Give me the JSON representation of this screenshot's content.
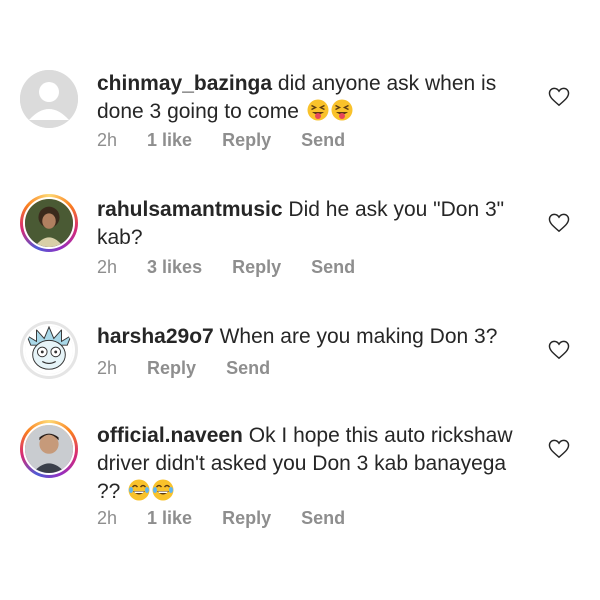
{
  "comments": [
    {
      "username": "chinmay_bazinga",
      "text": "did anyone ask when is done 3 going to come",
      "emojis": [
        "squinting-tongue-emoji",
        "squinting-tongue-emoji"
      ],
      "time": "2h",
      "likes": "1 like",
      "reply": "Reply",
      "send": "Send"
    },
    {
      "username": "rahulsamantmusic",
      "text": "Did he ask you \"Don 3\" kab?",
      "time": "2h",
      "likes": "3 likes",
      "reply": "Reply",
      "send": "Send"
    },
    {
      "username": "harsha29o7",
      "text": "When are you making Don 3?",
      "time": "2h",
      "reply": "Reply",
      "send": "Send"
    },
    {
      "username": "official.naveen",
      "text": "Ok I hope this auto rickshaw driver didn't asked you Don 3 kab banayega ??",
      "emojis": [
        "laughing-emoji",
        "laughing-emoji"
      ],
      "time": "2h",
      "likes": "1 like",
      "reply": "Reply",
      "send": "Send"
    }
  ],
  "colors": {
    "text": "#262626",
    "meta": "#8e8e8e",
    "story_ring": [
      "#feda75",
      "#fa7e1e",
      "#d62976",
      "#962fbf",
      "#4f5bd5"
    ]
  }
}
